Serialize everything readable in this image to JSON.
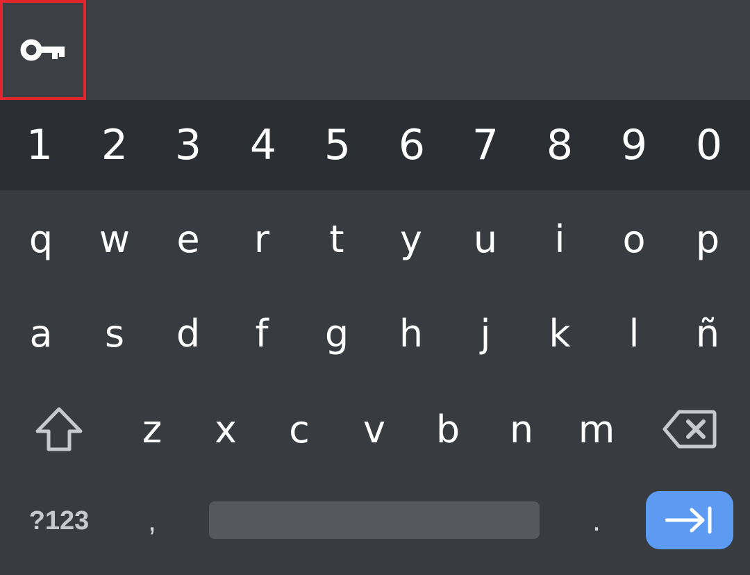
{
  "number_row": [
    "1",
    "2",
    "3",
    "4",
    "5",
    "6",
    "7",
    "8",
    "9",
    "0"
  ],
  "row1": [
    "q",
    "w",
    "e",
    "r",
    "t",
    "y",
    "u",
    "i",
    "o",
    "p"
  ],
  "row2": [
    "a",
    "s",
    "d",
    "f",
    "g",
    "h",
    "j",
    "k",
    "l",
    "ñ"
  ],
  "row3": [
    "z",
    "x",
    "c",
    "v",
    "b",
    "n",
    "m"
  ],
  "bottom": {
    "symbols_label": "?123",
    "comma": ",",
    "period": "."
  },
  "icons": {
    "toolbar": "key-icon",
    "shift": "shift-arrow-icon",
    "backspace": "backspace-icon",
    "enter": "tab-next-icon"
  },
  "colors": {
    "background": "#383b40",
    "number_row_background": "#2b2e32",
    "highlight_box": "#e3262c",
    "enter_key": "#5d9af2",
    "space_bar": "#55585c"
  }
}
